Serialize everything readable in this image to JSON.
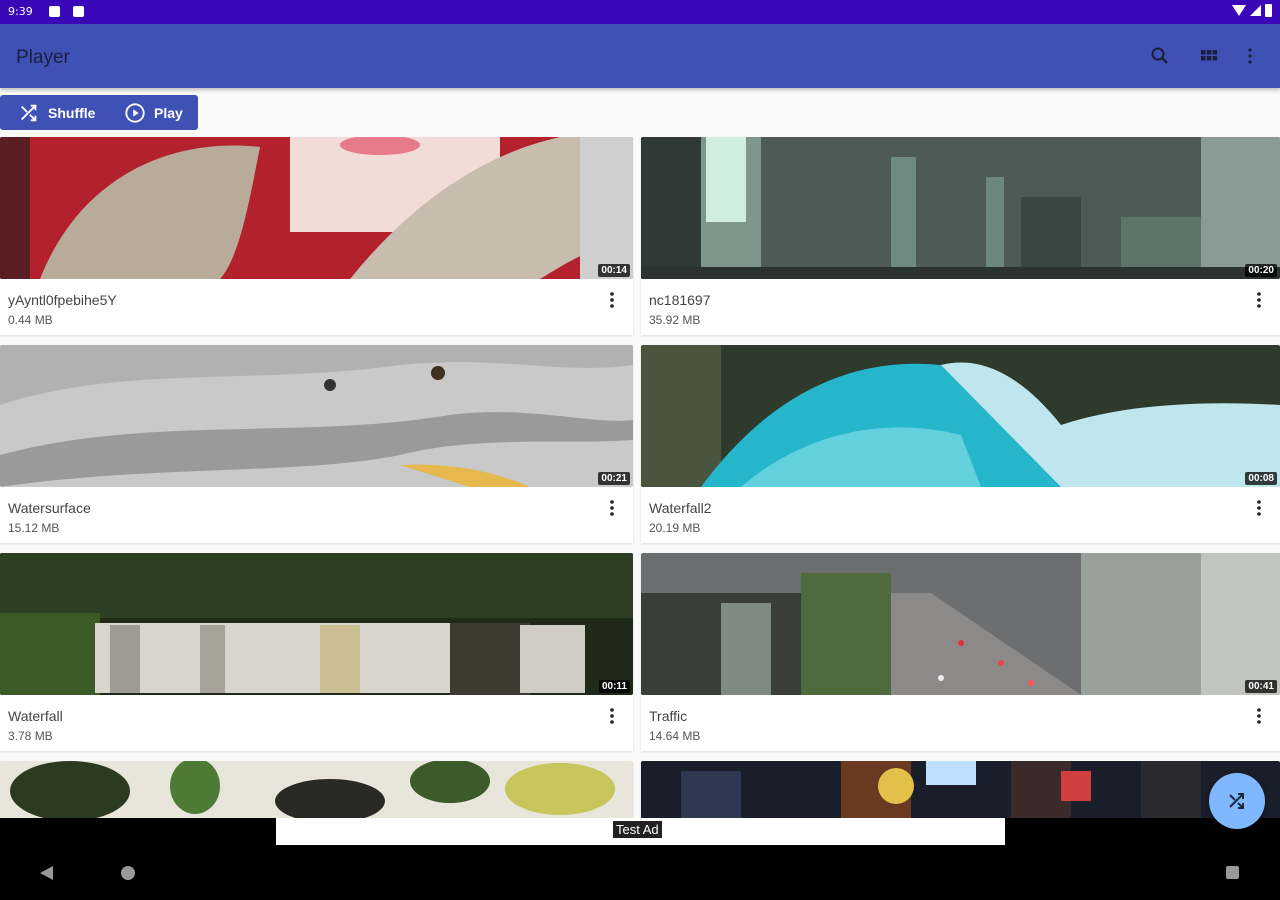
{
  "status_bar": {
    "time": "9:39"
  },
  "app_bar": {
    "title": "Player"
  },
  "actions": {
    "shuffle_label": "Shuffle",
    "play_label": "Play"
  },
  "videos": [
    {
      "name": "yAyntl0fpebihe5Y",
      "size": "0.44 MB",
      "duration": "00:14"
    },
    {
      "name": "nc181697",
      "size": "35.92 MB",
      "duration": "00:20"
    },
    {
      "name": "Watersurface",
      "size": "15.12 MB",
      "duration": "00:21"
    },
    {
      "name": "Waterfall2",
      "size": "20.19 MB",
      "duration": "00:08"
    },
    {
      "name": "Waterfall",
      "size": "3.78 MB",
      "duration": "00:11"
    },
    {
      "name": "Traffic",
      "size": "14.64 MB",
      "duration": "00:41"
    }
  ],
  "ad": {
    "label": "Test Ad"
  },
  "colors": {
    "status_bar": "#3a07b8",
    "app_bar": "#3f51b5",
    "fab": "#80b8ff"
  },
  "icons": [
    "search-icon",
    "grid-view-icon",
    "more-vert-icon",
    "shuffle-icon",
    "play-circle-icon",
    "back-icon",
    "home-icon",
    "recents-icon"
  ]
}
